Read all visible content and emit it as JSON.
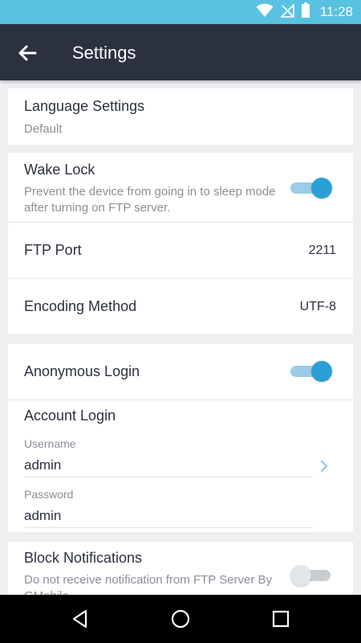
{
  "status_bar": {
    "time": "11:28"
  },
  "app_bar": {
    "title": "Settings"
  },
  "language": {
    "title": "Language Settings",
    "value": "Default"
  },
  "wake_lock": {
    "title": "Wake Lock",
    "description": "Prevent the device from going in to sleep mode after turning on FTP server.",
    "enabled": true
  },
  "ftp_port": {
    "title": "FTP Port",
    "value": "2211"
  },
  "encoding": {
    "title": "Encoding Method",
    "value": "UTF-8"
  },
  "anonymous_login": {
    "title": "Anonymous Login",
    "enabled": true
  },
  "account_login": {
    "title": "Account Login",
    "username_label": "Username",
    "username_value": "admin",
    "password_label": "Password",
    "password_value": "admin"
  },
  "block_notifications": {
    "title": "Block Notifications",
    "description": "Do not receive notification from FTP Server By GMobile",
    "enabled": false
  },
  "colors": {
    "status_bar": "#58c2e0",
    "app_bar": "#2c3140",
    "accent": "#2a9fd8",
    "background": "#eeeff1"
  },
  "icons": {
    "back": "arrow-left",
    "wifi": "wifi",
    "signal": "no-signal",
    "battery": "battery",
    "nav_back": "triangle",
    "nav_home": "circle",
    "nav_recent": "square",
    "chevron": "chevron-right"
  }
}
